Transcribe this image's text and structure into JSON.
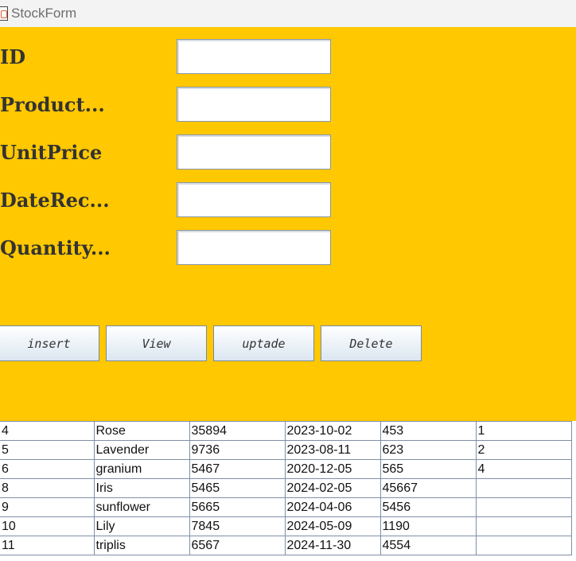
{
  "window": {
    "title": "StockForm",
    "icon": "java-icon"
  },
  "form": {
    "fields": [
      {
        "label": "ID",
        "value": ""
      },
      {
        "label": "Product...",
        "value": ""
      },
      {
        "label": "UnitPrice",
        "value": ""
      },
      {
        "label": "DateRec...",
        "value": ""
      },
      {
        "label": "Quantity...",
        "value": ""
      }
    ]
  },
  "buttons": {
    "insert": "insert",
    "view": "View",
    "update": "uptade",
    "delete": "Delete"
  },
  "table": {
    "rows": [
      [
        "4",
        "Rose",
        "35894",
        "2023-10-02",
        "453",
        "1"
      ],
      [
        "5",
        "Lavender",
        "9736",
        "2023-08-11",
        "623",
        "2"
      ],
      [
        "6",
        "granium",
        "5467",
        "2020-12-05",
        "565",
        "4"
      ],
      [
        "8",
        "Iris",
        "5465",
        "2024-02-05",
        "45667",
        ""
      ],
      [
        "9",
        "sunflower",
        "5665",
        "2024-04-06",
        "5456",
        ""
      ],
      [
        "10",
        "Lily",
        "7845",
        "2024-05-09",
        "1190",
        ""
      ],
      [
        "11",
        "triplis",
        "6567",
        "2024-11-30",
        "4554",
        ""
      ]
    ]
  },
  "colors": {
    "panel": "#ffc800",
    "label": "#333333",
    "button_bottom": "#dbe6f1"
  }
}
